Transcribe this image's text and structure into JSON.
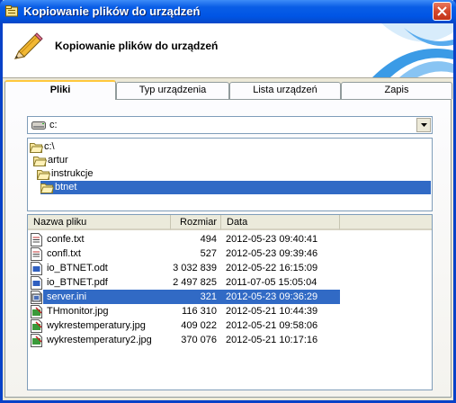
{
  "window": {
    "title": "Kopiowanie plików do urządzeń"
  },
  "header": {
    "title": "Kopiowanie plików do urządzeń"
  },
  "tabs": [
    {
      "label": "Pliki",
      "active": true
    },
    {
      "label": "Typ urządzenia",
      "active": false
    },
    {
      "label": "Lista urządzeń",
      "active": false
    },
    {
      "label": "Zapis",
      "active": false
    }
  ],
  "drive": {
    "value": "c:"
  },
  "tree": [
    {
      "label": "c:\\"
    },
    {
      "label": "artur"
    },
    {
      "label": "instrukcje"
    },
    {
      "label": "btnet",
      "selected": true
    }
  ],
  "filelist": {
    "columns": {
      "name": "Nazwa pliku",
      "size": "Rozmiar",
      "date": "Data"
    },
    "rows": [
      {
        "name": "confe.txt",
        "size": "494",
        "date": "2012-05-23 09:40:41",
        "icon": "text-file-icon"
      },
      {
        "name": "confl.txt",
        "size": "527",
        "date": "2012-05-23 09:39:46",
        "icon": "text-file-icon"
      },
      {
        "name": "io_BTNET.odt",
        "size": "3 032 839",
        "date": "2012-05-22 16:15:09",
        "icon": "document-file-icon"
      },
      {
        "name": "io_BTNET.pdf",
        "size": "2 497 825",
        "date": "2011-07-05 15:05:04",
        "icon": "document-file-icon"
      },
      {
        "name": "server.ini",
        "size": "321",
        "date": "2012-05-23 09:36:29",
        "icon": "settings-file-icon",
        "selected": true
      },
      {
        "name": "THmonitor.jpg",
        "size": "116 310",
        "date": "2012-05-21 10:44:39",
        "icon": "image-file-icon"
      },
      {
        "name": "wykrestemperatury.jpg",
        "size": "409 022",
        "date": "2012-05-21 09:58:06",
        "icon": "image-file-icon"
      },
      {
        "name": "wykrestemperatury2.jpg",
        "size": "370 076",
        "date": "2012-05-21 10:17:16",
        "icon": "image-file-icon"
      }
    ]
  },
  "colors": {
    "titlebar": "#0055e5",
    "selection": "#316ac5",
    "active_tab_accent": "#ffc83c"
  }
}
